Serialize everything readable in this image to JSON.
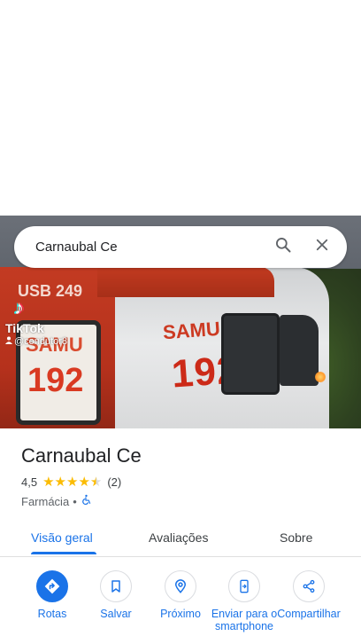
{
  "search": {
    "query": "Carnaubal Ce"
  },
  "photo": {
    "vehicle_text_front": "SAMU",
    "vehicle_number_front": "192",
    "vehicle_text_side": "SAMU",
    "vehicle_number_side": "192",
    "vehicle_code": "USB 249",
    "watermark": {
      "brand": "TikTok",
      "user": "@condutor8"
    }
  },
  "place": {
    "name": "Carnaubal Ce",
    "rating": "4,5",
    "rating_value": 4.5,
    "review_count": "(2)",
    "category": "Farmácia",
    "separator": "•",
    "accessibility_icon": "wheelchair-icon"
  },
  "tabs": [
    {
      "label": "Visão geral",
      "active": true
    },
    {
      "label": "Avaliações",
      "active": false
    },
    {
      "label": "Sobre",
      "active": false
    }
  ],
  "actions": [
    {
      "label": "Rotas",
      "icon": "directions-icon",
      "primary": true
    },
    {
      "label": "Salvar",
      "icon": "bookmark-icon",
      "primary": false
    },
    {
      "label": "Próximo",
      "icon": "nearby-icon",
      "primary": false
    },
    {
      "label": "Enviar para o smartphone",
      "icon": "send-to-phone-icon",
      "primary": false
    },
    {
      "label": "Compartilhar",
      "icon": "share-icon",
      "primary": false
    }
  ],
  "colors": {
    "accent": "#1a73e8",
    "star": "#fbbc04",
    "text": "#202124"
  }
}
